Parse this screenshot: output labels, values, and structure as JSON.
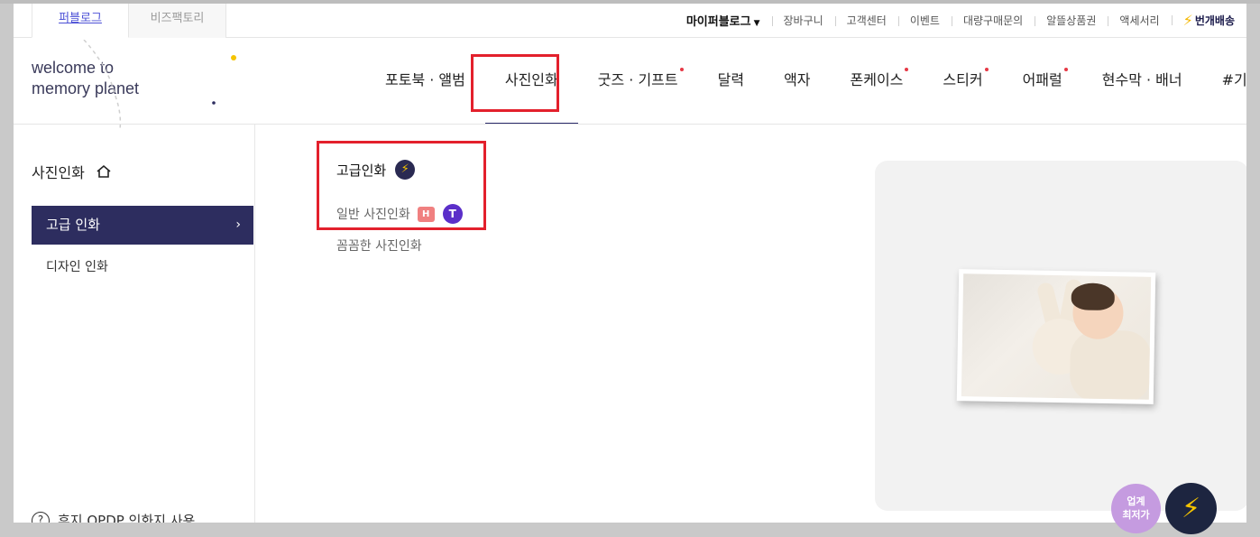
{
  "site_tabs": [
    "퍼블로그",
    "비즈팩토리"
  ],
  "util_links": {
    "my": "마이퍼블로그",
    "items": [
      "장바구니",
      "고객센터",
      "이벤트",
      "대량구매문의",
      "알뜰상품권",
      "액세서리"
    ],
    "fast": "번개배송"
  },
  "logo": {
    "line1": "welcome to",
    "line2": "memory planet"
  },
  "nav": [
    {
      "label": "포토북 · 앨범",
      "dot": false
    },
    {
      "label": "사진인화",
      "dot": false,
      "active": true
    },
    {
      "label": "굿즈 · 기프트",
      "dot": true
    },
    {
      "label": "달력",
      "dot": false
    },
    {
      "label": "액자",
      "dot": false
    },
    {
      "label": "폰케이스",
      "dot": true
    },
    {
      "label": "스티커",
      "dot": true
    },
    {
      "label": "어패럴",
      "dot": true
    },
    {
      "label": "현수막 · 배너",
      "dot": false
    },
    {
      "label": "#기획전",
      "dot": true
    }
  ],
  "sidebar": {
    "title": "사진인화",
    "items": [
      {
        "label": "고급 인화",
        "active": true
      },
      {
        "label": "디자인 인화",
        "active": false
      }
    ],
    "help": "후지 QPDP 인화지 사용"
  },
  "submenu": {
    "title": "고급인화",
    "links": [
      {
        "label": "일반 사진인화",
        "badge_h": "H",
        "badge_t": "T"
      },
      {
        "label": "꼼꼼한 사진인화"
      }
    ]
  },
  "float": {
    "low_line1": "업계",
    "low_line2": "최저가"
  },
  "colors": {
    "accent": "#2d2d5f",
    "highlight": "#e3202c",
    "purple": "#5b2fc9"
  }
}
